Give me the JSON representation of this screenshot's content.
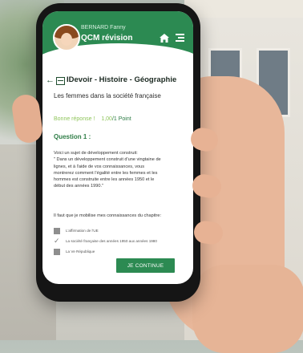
{
  "header": {
    "user_name": "BERNARD Fanny",
    "app_title": "QCM révision"
  },
  "breadcrumb": {
    "title": "IDevoir - Histoire - Géographie"
  },
  "subject": "Les femmes dans la société française",
  "score": {
    "label": "Bonne réponse !",
    "value": "1,00",
    "points": "/1 Point"
  },
  "question": {
    "label": "Question 1 :",
    "lines": [
      "Voici un sujet de développement construit:",
      "\" Dans un développement construit d'une vingtaine de",
      "lignes, et à l'aide de vos connaissances, vous",
      "montrerez comment l'égalité entre les femmes et les",
      "hommes est construite entre les années 1950 et le",
      "début des années 1990.\""
    ],
    "instruction": "Il faut que je mobilise mes connaissances du chapitre:"
  },
  "answers": [
    {
      "label": "L'affirmation de l'UE",
      "checked": false
    },
    {
      "label": "La société française des années 1950 aux années 1980",
      "checked": true
    },
    {
      "label": "La Ve République",
      "checked": false
    }
  ],
  "continue_label": "JE CONTINUE",
  "colors": {
    "primary": "#2c8a52",
    "score_green": "#8fc55b",
    "question_green": "#2e7d46"
  }
}
